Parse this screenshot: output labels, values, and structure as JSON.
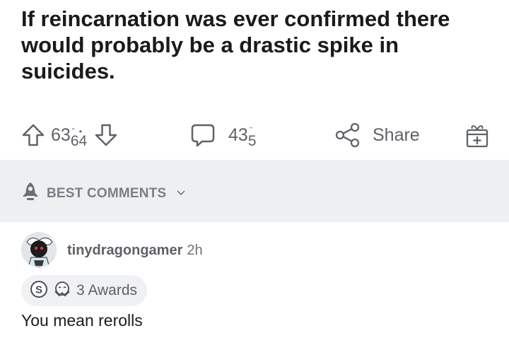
{
  "post": {
    "title": "If reincarnation was ever confirmed there would probably be a drastic spike in suicides."
  },
  "actions": {
    "upvote_icon": "arrow-up-icon",
    "vote_count_prefix": "63",
    "vote_count_rolling": "64",
    "downvote_icon": "arrow-down-icon",
    "comment_icon": "speech-bubble-icon",
    "comment_count_prefix": "43",
    "comment_count_rolling": "5",
    "share_icon": "share-nodes-icon",
    "share_label": "Share",
    "award_icon": "gift-plus-icon"
  },
  "sort": {
    "icon": "rocket-icon",
    "label": "BEST COMMENTS",
    "chevron": "chevron-down-icon"
  },
  "comment": {
    "author": "tinydragongamer",
    "age": "2h",
    "awards_label": "3 Awards",
    "body": "You mean rerolls"
  },
  "colors": {
    "title": "#1a1a1b",
    "meta": "#5f6368",
    "band": "#eeeff1",
    "award_pill": "#f0f1f3"
  }
}
